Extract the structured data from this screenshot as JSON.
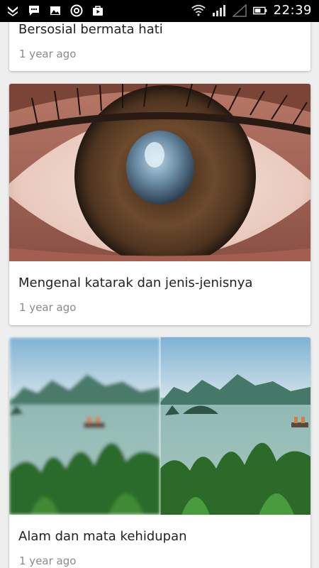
{
  "status_bar": {
    "time": "22:39",
    "icons": [
      "download-icon",
      "chat-icon",
      "gallery-icon",
      "chrome-icon",
      "play-store-icon",
      "wifi-icon",
      "signal-icon",
      "no-signal-icon",
      "battery-icon"
    ]
  },
  "feed": {
    "items": [
      {
        "title": "Bersosial bermata hati",
        "time": "1 year ago"
      },
      {
        "title": "Mengenal katarak dan jenis-jenisnya",
        "time": "1 year ago",
        "image": "eye-with-cataract"
      },
      {
        "title": "Alam dan mata kehidupan",
        "time": "1 year ago",
        "image": "bay-landscape-blur-comparison"
      }
    ]
  }
}
